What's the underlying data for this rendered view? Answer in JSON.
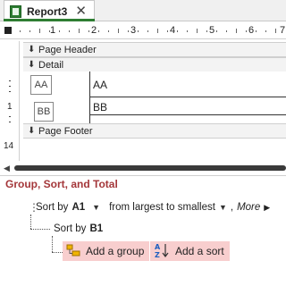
{
  "tab": {
    "title": "Report3",
    "close_glyph": "✕",
    "icon": "report-icon"
  },
  "ruler": {
    "numbers": [
      "1",
      "2",
      "3",
      "4",
      "5",
      "6",
      "7"
    ]
  },
  "vruler": {
    "numbers": [
      "1"
    ],
    "footer_marker": "14"
  },
  "sections": {
    "page_header": "Page Header",
    "detail": "Detail",
    "page_footer": "Page Footer"
  },
  "detail": {
    "label_a": "AA",
    "label_b": "BB",
    "field_a": "AA",
    "field_b": "BB"
  },
  "group_sort_total": {
    "title": "Group, Sort, and Total",
    "sort_row_1": {
      "prefix": "Sort by",
      "field": "A1",
      "order": "from largest to smallest",
      "more": "More"
    },
    "sort_row_2": {
      "prefix": "Sort by",
      "field": "B1"
    },
    "add_group_label": "Add a group",
    "add_sort_label": "Add a sort",
    "title_color": "#a4373a",
    "button_bg": "#f8cece"
  }
}
